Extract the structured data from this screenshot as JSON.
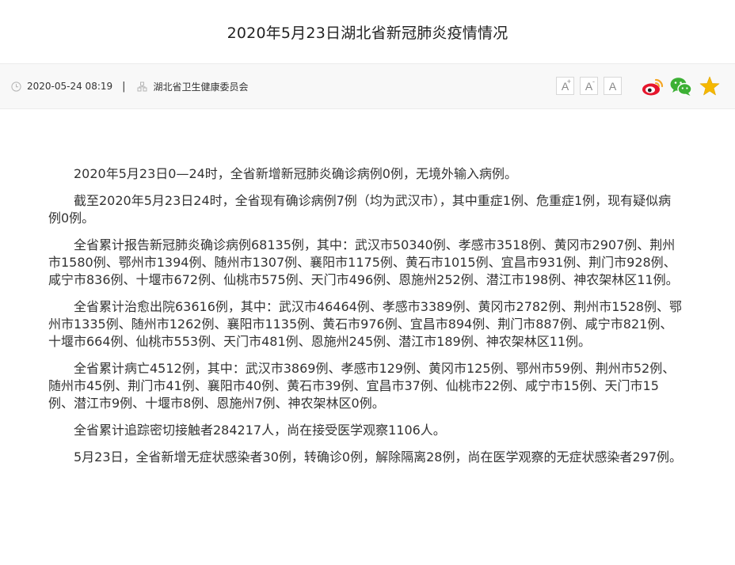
{
  "header": {
    "title": "2020年5月23日湖北省新冠肺炎疫情情况"
  },
  "meta": {
    "datetime": "2020-05-24 08:19",
    "separator": "|",
    "source": "湖北省卫生健康委员会",
    "font_buttons": [
      {
        "label": "A",
        "mark": "+"
      },
      {
        "label": "A",
        "mark": "-"
      },
      {
        "label": "A",
        "mark": ""
      }
    ],
    "share_icons": [
      "weibo-icon",
      "wechat-icon",
      "favorite-star-icon"
    ],
    "colors": {
      "weibo": "#e6162d",
      "wechat": "#3cb034",
      "star": "#f5b800"
    }
  },
  "article": {
    "paragraphs": [
      "2020年5月23日0—24时，全省新增新冠肺炎确诊病例0例，无境外输入病例。",
      "截至2020年5月23日24时，全省现有确诊病例7例（均为武汉市），其中重症1例、危重症1例，现有疑似病例0例。",
      "全省累计报告新冠肺炎确诊病例68135例，其中：武汉市50340例、孝感市3518例、黄冈市2907例、荆州市1580例、鄂州市1394例、随州市1307例、襄阳市1175例、黄石市1015例、宜昌市931例、荆门市928例、咸宁市836例、十堰市672例、仙桃市575例、天门市496例、恩施州252例、潜江市198例、神农架林区11例。",
      "全省累计治愈出院63616例，其中：武汉市46464例、孝感市3389例、黄冈市2782例、荆州市1528例、鄂州市1335例、随州市1262例、襄阳市1135例、黄石市976例、宜昌市894例、荆门市887例、咸宁市821例、十堰市664例、仙桃市553例、天门市481例、恩施州245例、潜江市189例、神农架林区11例。",
      "全省累计病亡4512例，其中：武汉市3869例、孝感市129例、黄冈市125例、鄂州市59例、荆州市52例、随州市45例、荆门市41例、襄阳市40例、黄石市39例、宜昌市37例、仙桃市22例、咸宁市15例、天门市15例、潜江市9例、十堰市8例、恩施州7例、神农架林区0例。",
      "全省累计追踪密切接触者284217人，尚在接受医学观察1106人。",
      "5月23日，全省新增无症状感染者30例，转确诊0例，解除隔离28例，尚在医学观察的无症状感染者297例。"
    ]
  }
}
